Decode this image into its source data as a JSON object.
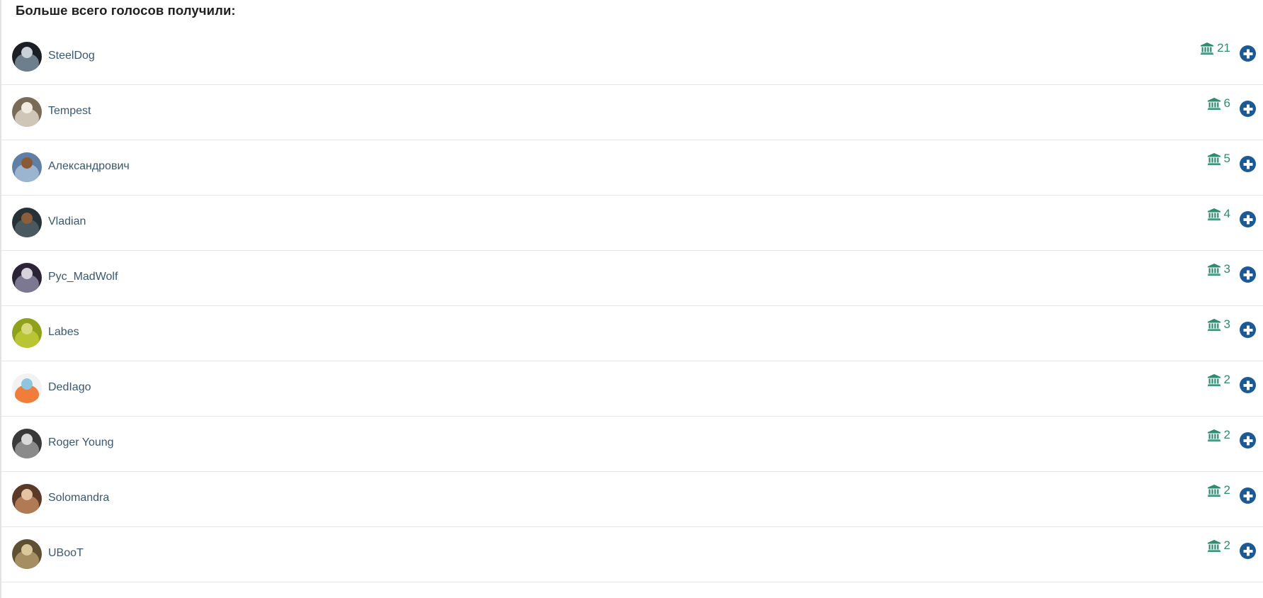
{
  "heading": "Больше всего голосов получили:",
  "colors": {
    "vote_green": "#2e8b6f",
    "add_blue": "#1c5a96",
    "name_text": "#3a5770"
  },
  "icons": {
    "vote_icon": "bank-building-icon",
    "add_icon": "plus-circle-icon"
  },
  "users": [
    {
      "name": "SteelDog",
      "votes": "21",
      "avatar_colors": [
        "#1b1e24",
        "#6d7f8c",
        "#c9d0d6"
      ]
    },
    {
      "name": "Tempest",
      "votes": "6",
      "avatar_colors": [
        "#7a6a58",
        "#cfc6b8",
        "#f1ebe2"
      ]
    },
    {
      "name": "Александрович",
      "votes": "5",
      "avatar_colors": [
        "#5f7fa5",
        "#9bb4cf",
        "#8a5a36"
      ]
    },
    {
      "name": "Vladian",
      "votes": "4",
      "avatar_colors": [
        "#263238",
        "#4a5960",
        "#8c5d3a"
      ]
    },
    {
      "name": "Pyc_MadWolf",
      "votes": "3",
      "avatar_colors": [
        "#2b2436",
        "#7c7891",
        "#d6d2dd"
      ]
    },
    {
      "name": "Labes",
      "votes": "3",
      "avatar_colors": [
        "#8fa11b",
        "#b9c532",
        "#d8d97b"
      ]
    },
    {
      "name": "DedIago",
      "votes": "2",
      "avatar_colors": [
        "#f2f2f2",
        "#f07d3a",
        "#8fc6de"
      ]
    },
    {
      "name": "Roger Young",
      "votes": "2",
      "avatar_colors": [
        "#3a3a3a",
        "#8a8a8a",
        "#d8d8d8"
      ]
    },
    {
      "name": "Solomandra",
      "votes": "2",
      "avatar_colors": [
        "#5a3a26",
        "#b07a55",
        "#e3c3a3"
      ]
    },
    {
      "name": "UBooT",
      "votes": "2",
      "avatar_colors": [
        "#5f5034",
        "#a58f62",
        "#d9c89a"
      ]
    }
  ]
}
